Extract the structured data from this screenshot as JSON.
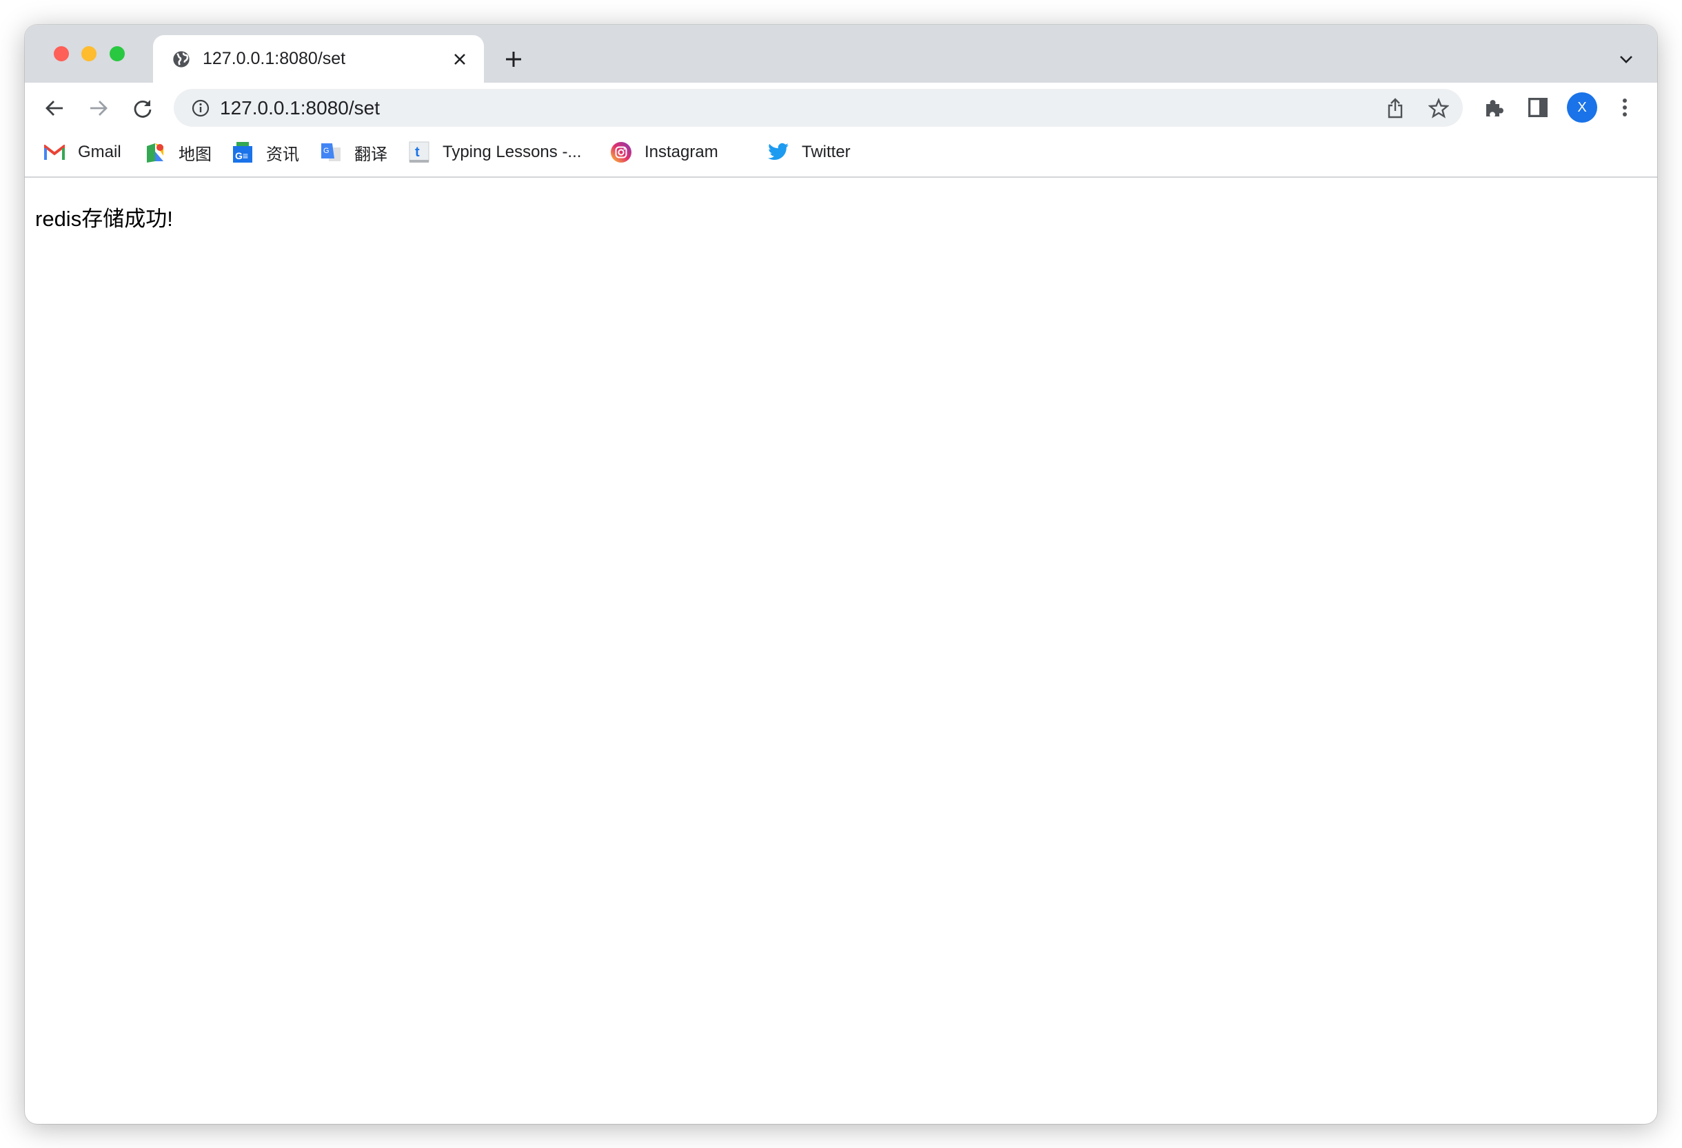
{
  "window": {
    "traffic_lights": [
      {
        "name": "close",
        "color": "#fe5f57"
      },
      {
        "name": "minimize",
        "color": "#febc2e"
      },
      {
        "name": "zoom",
        "color": "#28c840"
      }
    ]
  },
  "tab": {
    "title": "127.0.0.1:8080/set",
    "favicon": "globe-icon"
  },
  "toolbar": {
    "url": "127.0.0.1:8080/set",
    "avatar_letter": "X",
    "avatar_color": "#1a73e8"
  },
  "bookmarks": [
    {
      "label": "Gmail",
      "icon": "gmail-icon"
    },
    {
      "label": "地图",
      "icon": "maps-icon"
    },
    {
      "label": "资讯",
      "icon": "news-icon"
    },
    {
      "label": "翻译",
      "icon": "translate-icon"
    },
    {
      "label": "Typing Lessons -...",
      "icon": "typing-icon"
    },
    {
      "label": "Instagram",
      "icon": "instagram-icon"
    },
    {
      "label": "Twitter",
      "icon": "twitter-icon"
    }
  ],
  "page": {
    "message": "redis存储成功!"
  }
}
